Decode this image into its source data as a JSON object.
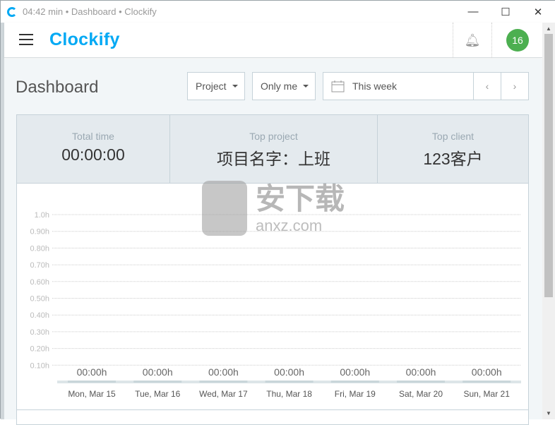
{
  "window": {
    "title": "04:42 min • Dashboard • Clockify",
    "minimize": "—",
    "maximize": "☐",
    "close": "✕"
  },
  "header": {
    "logo": "Clockify",
    "avatar": "16",
    "bell_icon": "bell-icon"
  },
  "page": {
    "title": "Dashboard"
  },
  "filters": {
    "project": "Project",
    "user": "Only me",
    "date_range": "This week",
    "prev": "‹",
    "next": "›"
  },
  "stats": [
    {
      "label": "Total time",
      "value": "00:00:00"
    },
    {
      "label": "Top project",
      "value": "项目名字：上班"
    },
    {
      "label": "Top client",
      "value": "123客户"
    }
  ],
  "watermark": {
    "line1": "安下载",
    "line2": "anxz.com"
  },
  "chart_data": {
    "type": "bar",
    "categories": [
      "Mon, Mar 15",
      "Tue, Mar 16",
      "Wed, Mar 17",
      "Thu, Mar 18",
      "Fri, Mar 19",
      "Sat, Mar 20",
      "Sun, Mar 21"
    ],
    "values": [
      0,
      0,
      0,
      0,
      0,
      0,
      0
    ],
    "data_labels": [
      "00:00h",
      "00:00h",
      "00:00h",
      "00:00h",
      "00:00h",
      "00:00h",
      "00:00h"
    ],
    "yticks": [
      "0.10h",
      "0.20h",
      "0.30h",
      "0.40h",
      "0.50h",
      "0.60h",
      "0.70h",
      "0.80h",
      "0.90h",
      "1.0h"
    ],
    "ylim": [
      0,
      1.0
    ],
    "grid": true,
    "bar_color": "#c9d6da"
  }
}
